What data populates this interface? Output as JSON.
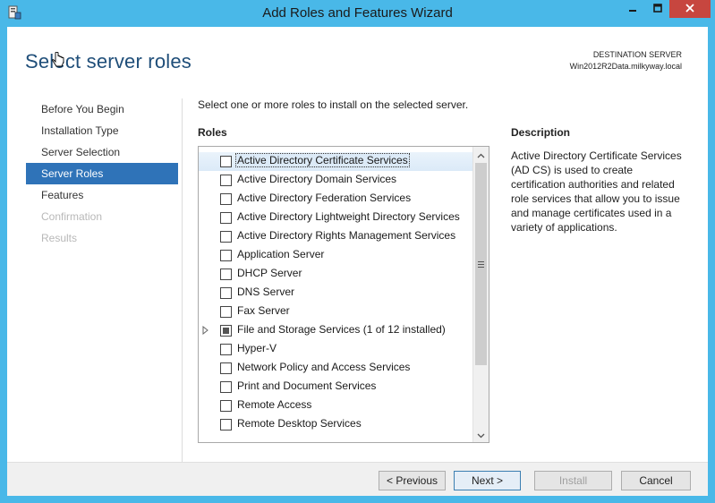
{
  "window": {
    "title": "Add Roles and Features Wizard"
  },
  "header": {
    "page_title": "Select server roles",
    "destination_label": "DESTINATION SERVER",
    "destination_value": "Win2012R2Data.milkyway.local"
  },
  "nav": {
    "items": [
      {
        "label": "Before You Begin",
        "state": "normal"
      },
      {
        "label": "Installation Type",
        "state": "normal"
      },
      {
        "label": "Server Selection",
        "state": "normal"
      },
      {
        "label": "Server Roles",
        "state": "active"
      },
      {
        "label": "Features",
        "state": "normal"
      },
      {
        "label": "Confirmation",
        "state": "disabled"
      },
      {
        "label": "Results",
        "state": "disabled"
      }
    ]
  },
  "main": {
    "instruction": "Select one or more roles to install on the selected server.",
    "roles_heading": "Roles",
    "roles": [
      {
        "label": "Active Directory Certificate Services",
        "checked": false,
        "selected": true,
        "expandable": false
      },
      {
        "label": "Active Directory Domain Services",
        "checked": false,
        "selected": false,
        "expandable": false
      },
      {
        "label": "Active Directory Federation Services",
        "checked": false,
        "selected": false,
        "expandable": false
      },
      {
        "label": "Active Directory Lightweight Directory Services",
        "checked": false,
        "selected": false,
        "expandable": false
      },
      {
        "label": "Active Directory Rights Management Services",
        "checked": false,
        "selected": false,
        "expandable": false
      },
      {
        "label": "Application Server",
        "checked": false,
        "selected": false,
        "expandable": false
      },
      {
        "label": "DHCP Server",
        "checked": false,
        "selected": false,
        "expandable": false
      },
      {
        "label": "DNS Server",
        "checked": false,
        "selected": false,
        "expandable": false
      },
      {
        "label": "Fax Server",
        "checked": false,
        "selected": false,
        "expandable": false
      },
      {
        "label": "File and Storage Services (1 of 12 installed)",
        "checked": "partial",
        "selected": false,
        "expandable": true
      },
      {
        "label": "Hyper-V",
        "checked": false,
        "selected": false,
        "expandable": false
      },
      {
        "label": "Network Policy and Access Services",
        "checked": false,
        "selected": false,
        "expandable": false
      },
      {
        "label": "Print and Document Services",
        "checked": false,
        "selected": false,
        "expandable": false
      },
      {
        "label": "Remote Access",
        "checked": false,
        "selected": false,
        "expandable": false
      },
      {
        "label": "Remote Desktop Services",
        "checked": false,
        "selected": false,
        "expandable": false
      }
    ],
    "description_heading": "Description",
    "description_text": "Active Directory Certificate Services (AD CS) is used to create certification authorities and related role services that allow you to issue and manage certificates used in a variety of applications."
  },
  "footer": {
    "previous_label": "< Previous",
    "next_label": "Next >",
    "install_label": "Install",
    "cancel_label": "Cancel"
  },
  "colors": {
    "titlebar": "#49b8e8",
    "nav_active": "#2f73b8",
    "close_button": "#c7463f",
    "page_title": "#1f4e79"
  },
  "icons": [
    "server-manager-icon",
    "minimize-icon",
    "maximize-icon",
    "close-icon",
    "expand-arrow-icon",
    "scroll-up-icon",
    "scroll-down-icon",
    "scroll-grip-icon",
    "hand-cursor-icon"
  ]
}
